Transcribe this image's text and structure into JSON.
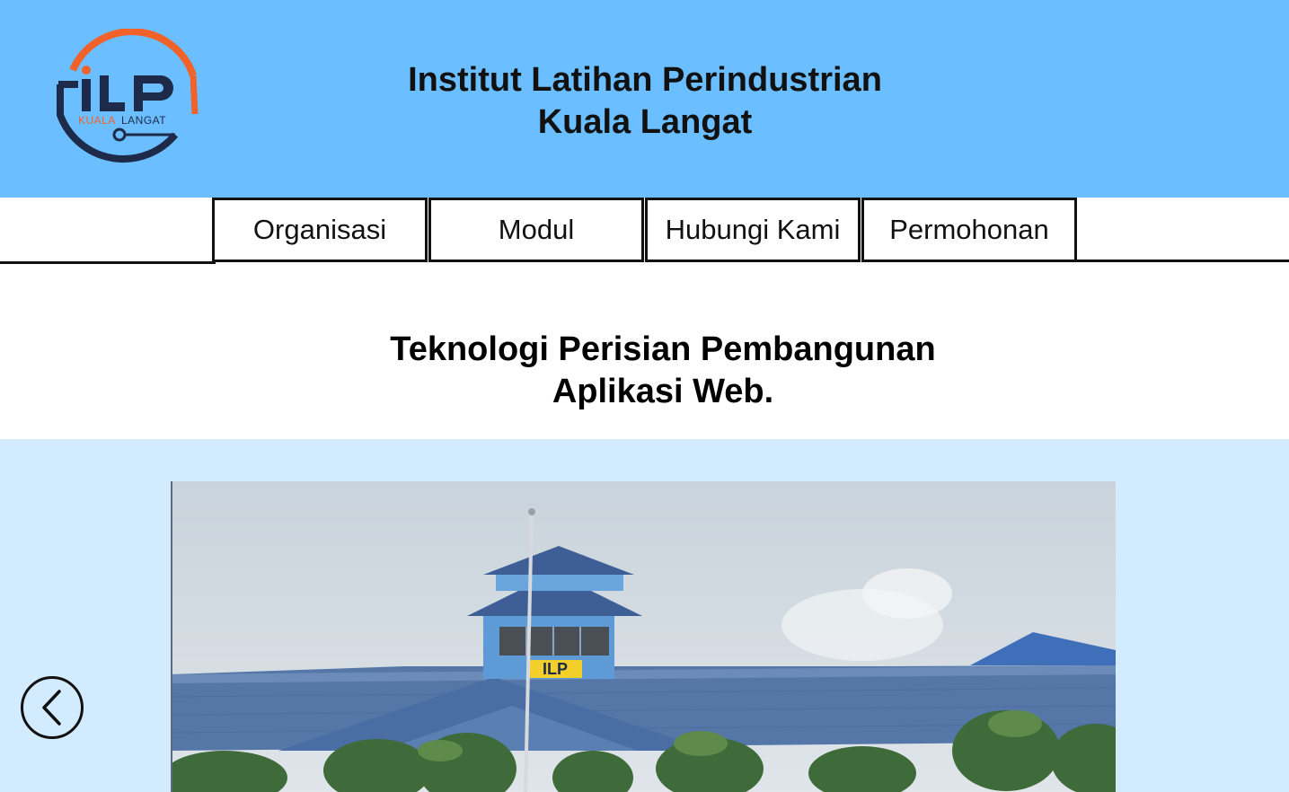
{
  "header": {
    "title_line1": "Institut Latihan Perindustrian",
    "title_line2": "Kuala Langat",
    "logo_text_main": "iLP",
    "logo_text_sub": "KUALALANGAT",
    "logo_icon": "ilp-logo",
    "background_color": "#6bbeff"
  },
  "nav": {
    "items": [
      {
        "label": "Organisasi"
      },
      {
        "label": "Modul"
      },
      {
        "label": "Hubungi Kami"
      },
      {
        "label": "Permohonan"
      }
    ]
  },
  "main": {
    "heading_line1": "Teknologi Perisian Pembangunan",
    "heading_line2": "Aplikasi Web."
  },
  "carousel": {
    "background_color": "#d3ebff",
    "prev_icon": "chevron-left-icon",
    "slide_sign_text": "ILP",
    "slide_image": "ILP building photograph"
  }
}
